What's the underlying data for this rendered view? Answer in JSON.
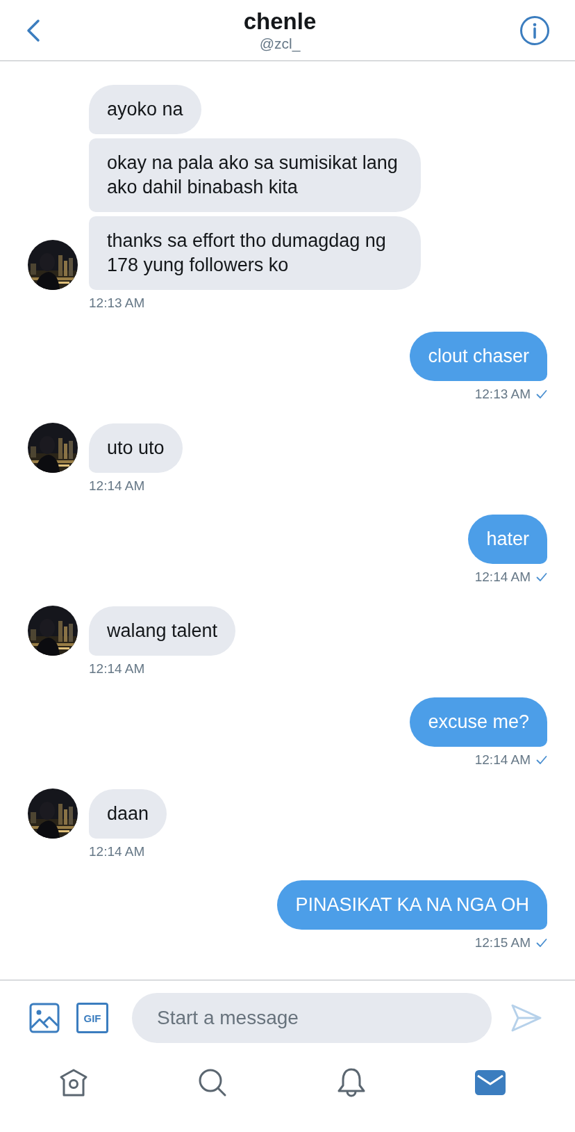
{
  "header": {
    "name": "chenle",
    "handle": "@zcl_"
  },
  "groups": [
    {
      "kind": "incoming",
      "bubbles": [
        "ayoko na",
        "okay na pala ako sa sumisikat lang ako dahil binabash kita",
        "thanks sa effort tho dumagdag ng 178 yung followers ko"
      ],
      "time": "12:13 AM"
    },
    {
      "kind": "outgoing",
      "bubbles": [
        "clout chaser"
      ],
      "time": "12:13 AM",
      "sent": true
    },
    {
      "kind": "incoming",
      "bubbles": [
        "uto uto"
      ],
      "time": "12:14 AM"
    },
    {
      "kind": "outgoing",
      "bubbles": [
        "hater"
      ],
      "time": "12:14 AM",
      "sent": true
    },
    {
      "kind": "incoming",
      "bubbles": [
        "walang talent"
      ],
      "time": "12:14 AM"
    },
    {
      "kind": "outgoing",
      "bubbles": [
        "excuse me?"
      ],
      "time": "12:14 AM",
      "sent": true
    },
    {
      "kind": "incoming",
      "bubbles": [
        "daan"
      ],
      "time": "12:14 AM"
    },
    {
      "kind": "outgoing",
      "bubbles": [
        "PINASIKAT KA NA NGA OH"
      ],
      "time": "12:15 AM",
      "sent": true
    }
  ],
  "composer": {
    "gif_label": "GIF",
    "placeholder": "Start a message"
  },
  "tabs": [
    {
      "kind": "home",
      "selected": false
    },
    {
      "kind": "search",
      "selected": false
    },
    {
      "kind": "notifications",
      "selected": false
    },
    {
      "kind": "messages",
      "selected": true
    }
  ]
}
